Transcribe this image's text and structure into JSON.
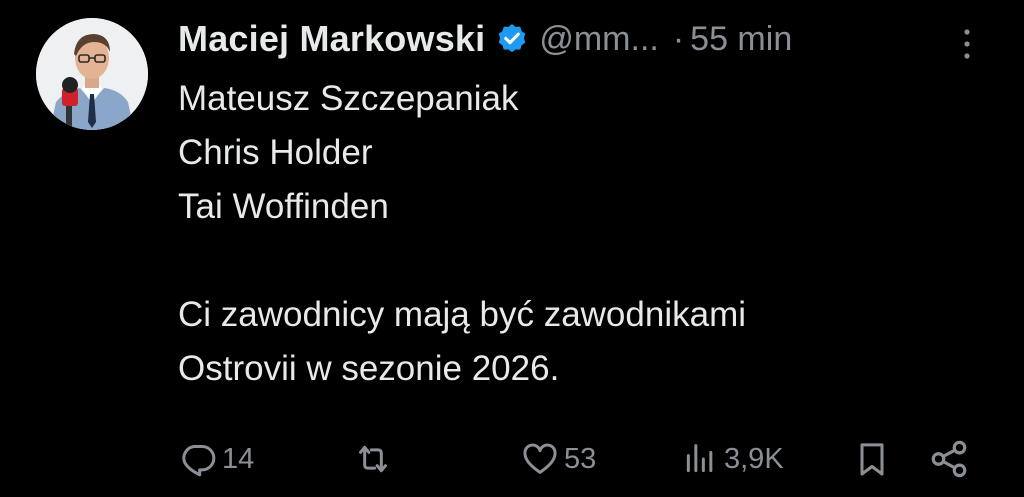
{
  "tweet": {
    "author": {
      "display_name": "Maciej Markowski",
      "handle": "@mm...",
      "verified": true,
      "avatar_icon": "avatar-photo"
    },
    "separator": "·",
    "time": "55 min",
    "body_lines": [
      "Mateusz Szczepaniak",
      "Chris Holder",
      "Tai Woffinden",
      "",
      "Ci zawodnicy mają być zawodnikami",
      "Ostrovii w sezonie 2026."
    ],
    "actions": {
      "reply": {
        "icon": "reply-icon",
        "count": "14"
      },
      "repost": {
        "icon": "repost-icon",
        "count": ""
      },
      "like": {
        "icon": "heart-icon",
        "count": "53"
      },
      "views": {
        "icon": "views-icon",
        "count": "3,9K"
      },
      "bookmark": {
        "icon": "bookmark-icon"
      },
      "share": {
        "icon": "share-icon"
      }
    },
    "colors": {
      "background": "#000000",
      "text": "#e7e9ea",
      "secondary": "#8b9096",
      "verified": "#1d9bf0"
    }
  }
}
